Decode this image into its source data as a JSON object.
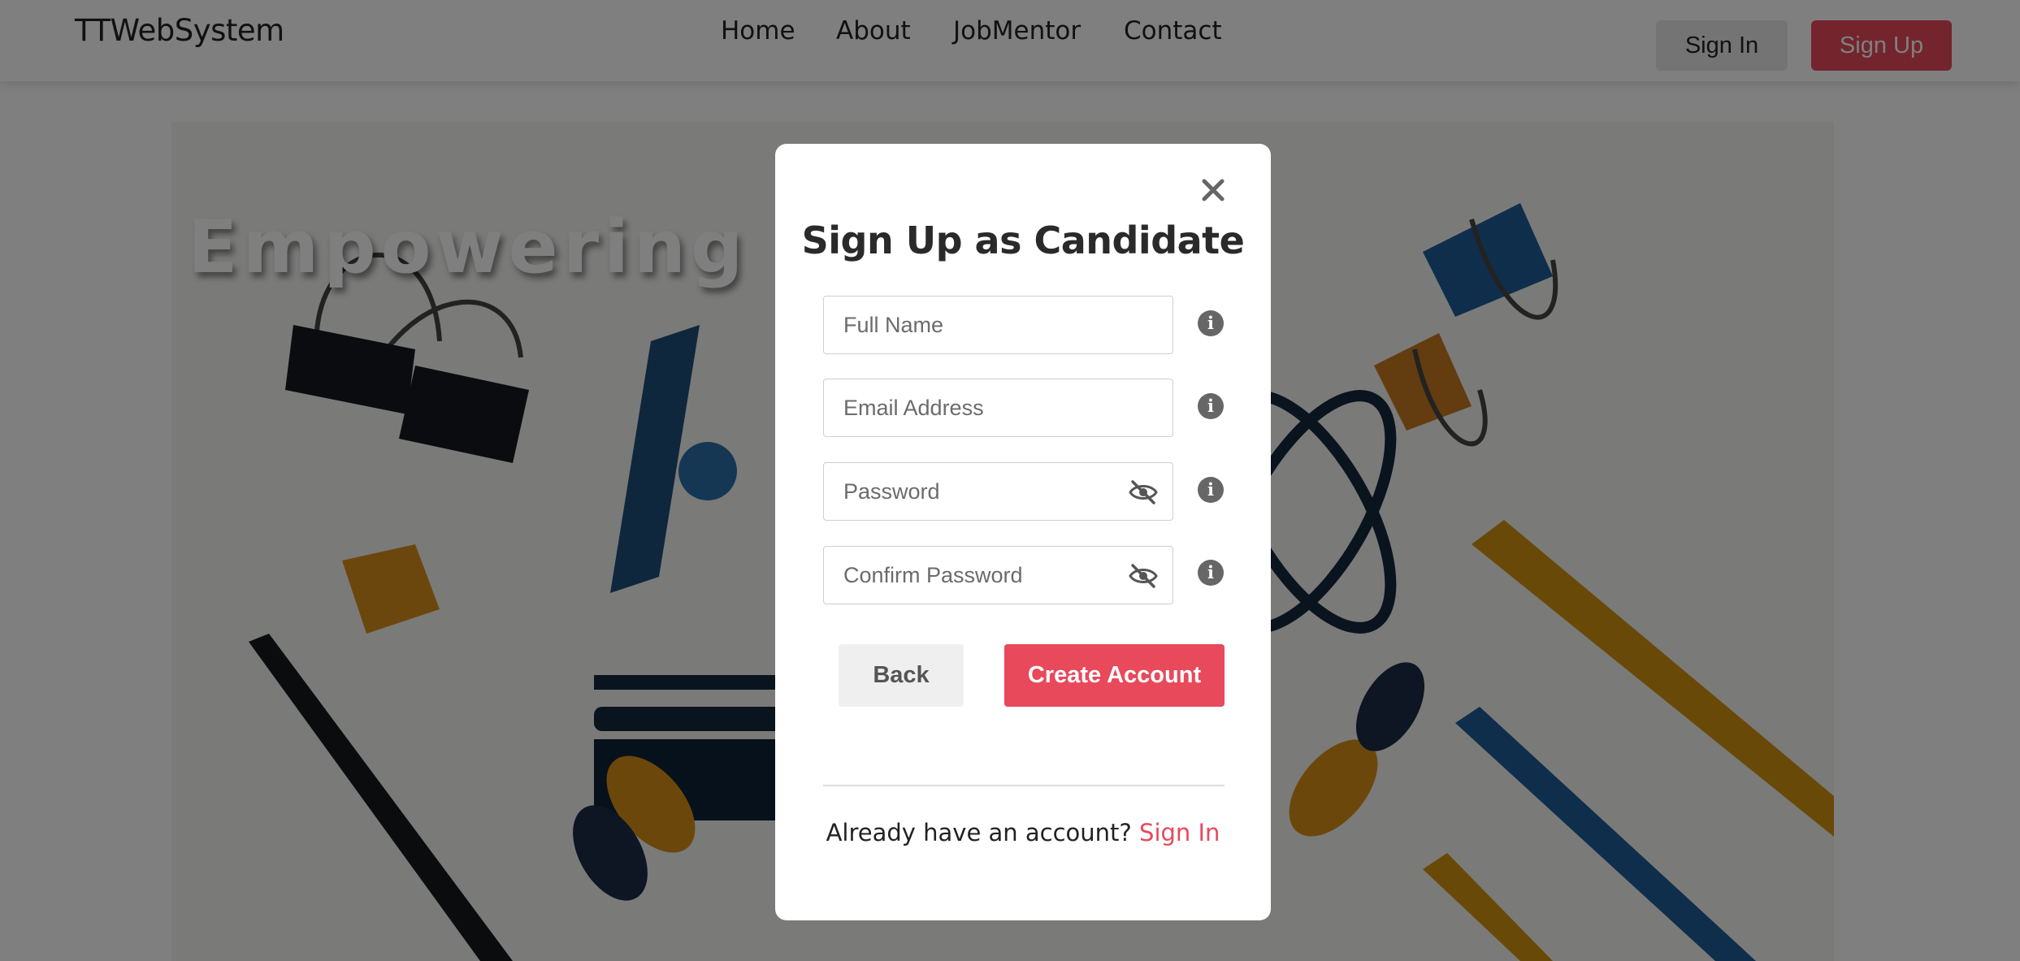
{
  "navbar": {
    "brand": "TTWebSystem",
    "links": [
      "Home",
      "About",
      "JobMentor",
      "Contact"
    ],
    "sign_in": "Sign In",
    "sign_up": "Sign Up"
  },
  "hero": {
    "title": "Empowering"
  },
  "modal": {
    "title": "Sign Up as Candidate",
    "fields": {
      "full_name": {
        "placeholder": "Full Name",
        "value": ""
      },
      "email": {
        "placeholder": "Email Address",
        "value": ""
      },
      "password": {
        "placeholder": "Password",
        "value": ""
      },
      "confirm_password": {
        "placeholder": "Confirm Password",
        "value": ""
      }
    },
    "back_label": "Back",
    "create_label": "Create Account",
    "footer_text": "Already have an account?",
    "footer_link": "Sign In"
  },
  "colors": {
    "accent": "#e8495b",
    "overlay": "rgba(0,0,0,0.5)"
  },
  "icons": [
    "close-icon",
    "info-icon",
    "eye-slash-icon"
  ]
}
